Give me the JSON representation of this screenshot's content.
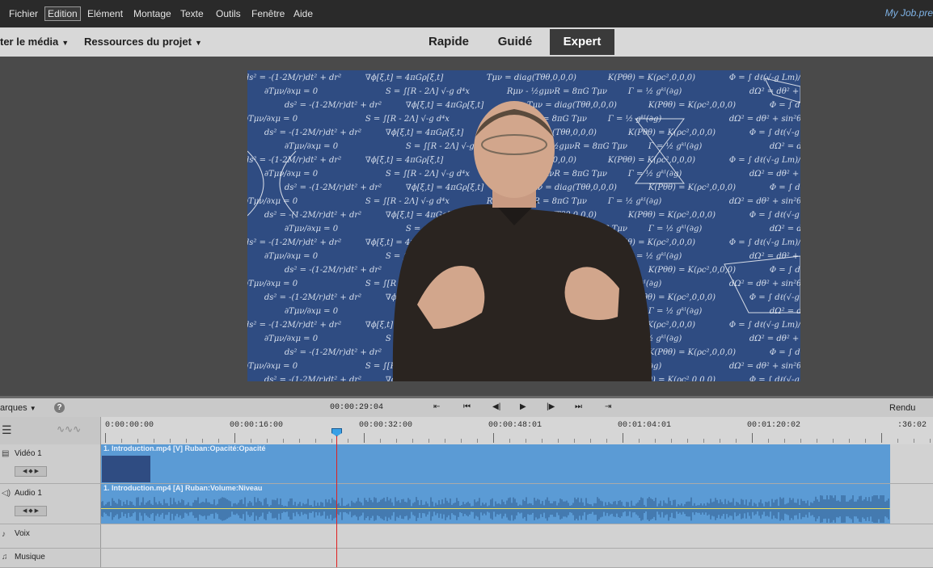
{
  "menu": {
    "items": [
      "Fichier",
      "Edition",
      "Elément",
      "Montage",
      "Texte",
      "Outils",
      "Fenêtre",
      "Aide"
    ],
    "active": "Edition",
    "project_title": "My Job.pre"
  },
  "toolbar": {
    "add_media_label": "ter le média",
    "project_assets_label": "Ressources du projet",
    "modes": [
      "Rapide",
      "Guidé",
      "Expert"
    ],
    "active_mode": "Expert"
  },
  "monitor": {
    "equations": [
      "ds² = -(1-2M/r)dt² + dr²",
      "∇ϕ[ξ,t] = 4πGρ[ξ,t]",
      "Tμν = diag(Tθθ,0,0,0)",
      "K(Pθθ) = K(ρc²,0,0,0)",
      "Φ = ∫ dℓ(√-g Lm)/dx",
      "∂Tμν/∂xμ = 0",
      "S = ∫[R - 2Λ] √-g d⁴x",
      "Rμν - ½gμνR = 8πG Tμν",
      "Γ = ½ gᵏˡ(∂g)",
      "dΩ² = dθ² + sin²θ dφ²"
    ]
  },
  "controls": {
    "markers_label": "arques",
    "help_label": "?",
    "current_time": "00:00:29:04",
    "render_label": "Rendu"
  },
  "ruler": {
    "timecodes": [
      "0:00:00:00",
      "00:00:16:00",
      "00:00:32:00",
      "00:00:48:01",
      "00:01:04:01",
      "00:01:20:02",
      ":36:02"
    ]
  },
  "tracks": {
    "video1": {
      "name": "Vidéo 1",
      "clip_title": "1. Introduction.mp4 [V] Ruban:Opacité:Opacité"
    },
    "audio1": {
      "name": "Audio 1",
      "clip_title": "1. Introduction.mp4 [A] Ruban:Volume:Niveau"
    },
    "voice": {
      "name": "Voix"
    },
    "music": {
      "name": "Musique"
    }
  },
  "colors": {
    "accent": "#5b9bd5",
    "playhead": "#e02020",
    "video_bg": "#2f4c82"
  }
}
